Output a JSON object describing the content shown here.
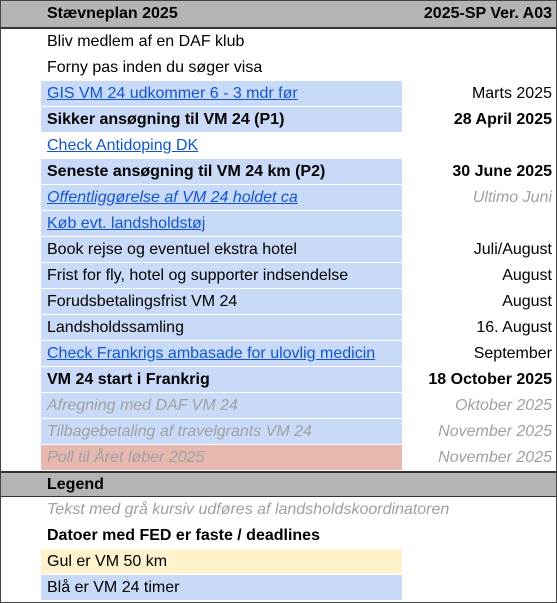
{
  "header": {
    "title": "Stævneplan 2025",
    "version": "2025-SP Ver. A03"
  },
  "rows": [
    {
      "label": "Bliv medlem af en DAF klub",
      "date": ""
    },
    {
      "label": "Forny pas inden du søger visa",
      "date": ""
    },
    {
      "label": "GIS VM 24 udkommer 6 - 3 mdr før",
      "date": "Marts 2025"
    },
    {
      "label": "Sikker ansøgning til VM 24 (P1)",
      "date": "28 April 2025"
    },
    {
      "label": "Check Antidoping DK",
      "date": ""
    },
    {
      "label": "Seneste ansøgning til VM 24 km (P2)",
      "date": "30 June 2025"
    },
    {
      "label": "Offentliggørelse af VM 24 holdet ca",
      "date": "Ultimo Juni"
    },
    {
      "label": "Køb evt. landsholdstøj",
      "date": ""
    },
    {
      "label": "Book rejse og eventuel ekstra hotel",
      "date": "Juli/August"
    },
    {
      "label": "Frist for fly, hotel og supporter indsendelse",
      "date": "August"
    },
    {
      "label": "Forudsbetalingsfrist VM 24",
      "date": "August"
    },
    {
      "label": "Landsholdssamling",
      "date": "16. August"
    },
    {
      "label": "Check Frankrigs ambasade for ulovlig medicin",
      "date": "September"
    },
    {
      "label": "VM 24 start i Frankrig",
      "date": "18 October 2025"
    },
    {
      "label": "Afregning med DAF VM 24",
      "date": "Oktober 2025"
    },
    {
      "label": "Tilbagebetaling af travelgrants VM 24",
      "date": "November 2025"
    },
    {
      "label": "Poll til Året løber 2025",
      "date": "November 2025"
    }
  ],
  "legend": {
    "title": "Legend",
    "items": [
      "Tekst med grå kursiv udføres af landsholdskoordinatoren",
      "Datoer med FED er faste / deadlines",
      "Gul er VM 50 km",
      "Blå er VM 24 timer"
    ]
  },
  "colors": {
    "header": "#b4b4b4",
    "blue": "#c9daf8",
    "pink": "#e6b8af",
    "yellow": "#fff2cc",
    "link": "#1155cc",
    "grey_text": "#a0a0a0"
  }
}
